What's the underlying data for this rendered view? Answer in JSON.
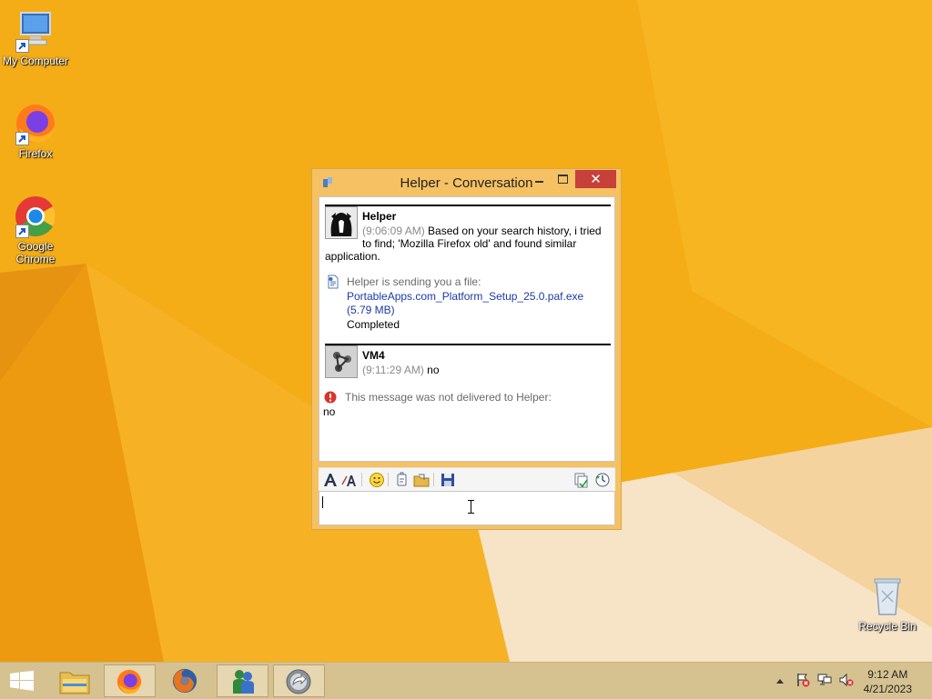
{
  "desktop": {
    "icons": [
      {
        "label": "My Computer"
      },
      {
        "label": "Firefox"
      },
      {
        "label": "Google Chrome"
      },
      {
        "label": "Recycle Bin"
      }
    ]
  },
  "window": {
    "title": "Helper - Conversation",
    "close_glyph": "✕",
    "messages": [
      {
        "sender": "Helper",
        "time": "(9:06:09 AM)",
        "text_line1": "Based on your search history, i tried",
        "text_line2": "to find; 'Mozilla Firefox old' and found similar",
        "text_line3": "application."
      },
      {
        "sender": "VM4",
        "time": "(9:11:29 AM)",
        "text": "no"
      }
    ],
    "file_transfer": {
      "intro": "Helper is sending you a file:",
      "file_name": "PortableApps.com_Platform_Setup_25.0.paf.exe",
      "file_size": "(5.79 MB)",
      "status": "Completed"
    },
    "error": {
      "text": "This message was not delivered to Helper:",
      "original": "no"
    },
    "input_value": ""
  },
  "taskbar": {
    "time": "9:12 AM",
    "date": "4/21/2023"
  },
  "colors": {
    "wallpaper": "#f4ad17",
    "window_frame": "#f5c163",
    "close_button": "#c7403a",
    "taskbar": "#d6c291",
    "link": "#1a3aa8"
  }
}
